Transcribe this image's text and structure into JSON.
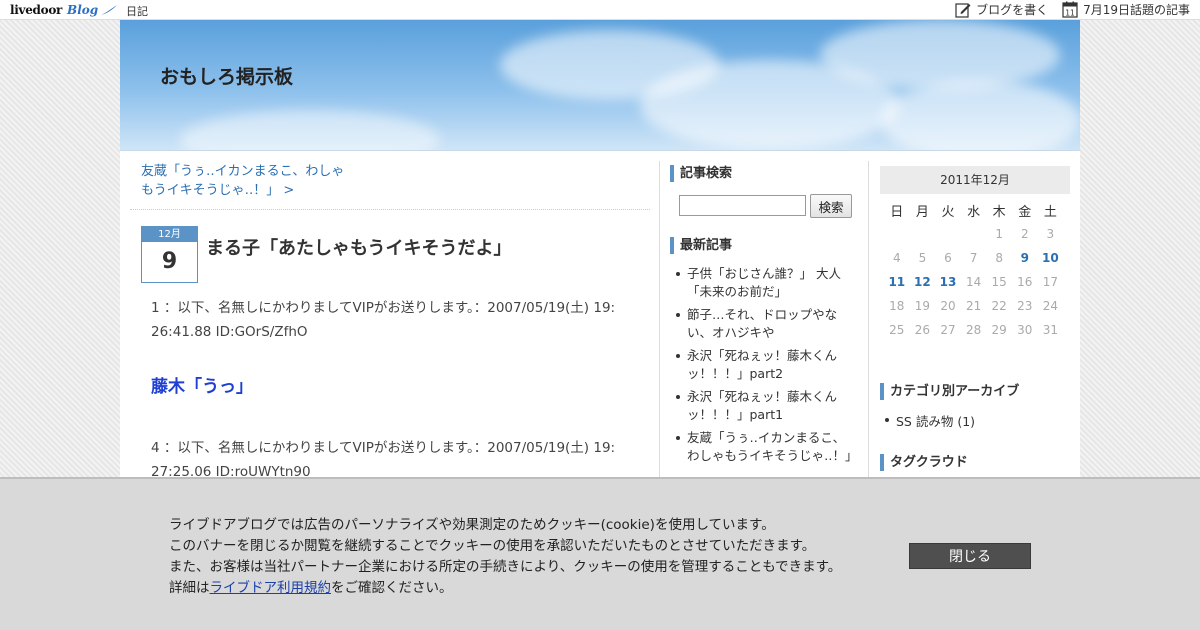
{
  "topbar": {
    "logo_livedoor": "livedoor",
    "logo_blog": "Blog",
    "nav_diary": "日記",
    "write_blog": "ブログを書く",
    "topic_articles": "7月19日話題の記事"
  },
  "header": {
    "site_title": "おもしろ掲示板"
  },
  "article": {
    "prev_link_line1": "友蔵「うぅ‥イカンまるこ、わしゃ",
    "prev_link_line2": "もうイキそうじゃ‥！」 >",
    "date_month": "12月",
    "date_day": "9",
    "title": "まる子「あたしゃもうイキそうだよ」",
    "res1_header_line1": "1 ：以下、名無しにかわりましてVIPがお送りします。：2007/05/19(土) 19:",
    "res1_header_line2": "26:41.88 ID:GOrS/ZfhO",
    "res1_body": "藤木「うっ」",
    "res4_header_line1": "4 ：以下、名無しにかわりましてVIPがお送りします。：2007/05/19(土) 19:",
    "res4_header_line2": "27:25.06 ID:roUWYtn90"
  },
  "sidebar": {
    "search_heading": "記事検索",
    "search_button": "検索",
    "search_value": "",
    "recent_heading": "最新記事",
    "recent_items": [
      "子供「おじさん誰？」 大人「未来のお前だ」",
      "節子…それ、ドロップやない、オハジキや",
      "永沢「死ねぇッ！藤木くんッ！！！」part2",
      "永沢「死ねぇッ！藤木くんッ！！！」part1",
      "友蔵「うぅ‥イカンまるこ、わしゃもうイキそうじゃ‥！」"
    ]
  },
  "calendar": {
    "title": "2011年12月",
    "weekdays": [
      "日",
      "月",
      "火",
      "水",
      "木",
      "金",
      "土"
    ],
    "weeks": [
      [
        "",
        "",
        "",
        "",
        "1",
        "2",
        "3"
      ],
      [
        "4",
        "5",
        "6",
        "7",
        "8",
        "9",
        "10"
      ],
      [
        "11",
        "12",
        "13",
        "14",
        "15",
        "16",
        "17"
      ],
      [
        "18",
        "19",
        "20",
        "21",
        "22",
        "23",
        "24"
      ],
      [
        "25",
        "26",
        "27",
        "28",
        "29",
        "30",
        "31"
      ]
    ],
    "linked_days": [
      "9",
      "10",
      "11",
      "12",
      "13"
    ]
  },
  "archive": {
    "heading": "カテゴリ別アーカイブ",
    "items": [
      "SS 読み物 (1)"
    ],
    "tagcloud_heading": "タグクラウド"
  },
  "cookie_banner": {
    "line1": "ライブドアブログでは広告のパーソナライズや効果測定のためクッキー(cookie)を使用しています。",
    "line2": "このバナーを閉じるか閲覧を継続することでクッキーの使用を承認いただいたものとさせていただきます。",
    "line3": "また、お客様は当社パートナー企業における所定の手続きにより、クッキーの使用を管理することもできます。",
    "line4_prefix": "詳細は",
    "line4_link": "ライブドア利用規約",
    "line4_suffix": "をご確認ください。",
    "close_label": "閉じる"
  },
  "icons": {
    "write": "pencil-note-icon",
    "calendar": "calendar-icon",
    "calendar_icon_day": "11"
  },
  "colors": {
    "accent": "#5b93c6",
    "link": "#2a6fb4",
    "title_blue": "#1f3fd4"
  }
}
